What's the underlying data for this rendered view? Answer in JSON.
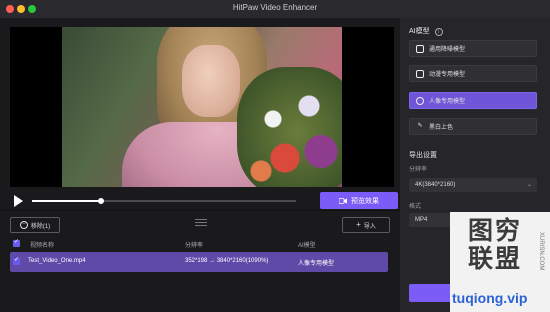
{
  "window": {
    "title": "HitPaw Video Enhancer"
  },
  "player": {
    "progress": 0.26,
    "preview_button": "预览效果"
  },
  "toolbar": {
    "remove_label": "移除(1)",
    "import_label": "导入"
  },
  "table": {
    "headers": [
      "视频名称",
      "分辨率",
      "AI模型"
    ],
    "rows": [
      {
        "name": "Test_Video_One.mp4",
        "resolution": "352*198 → 3840*2160(1090%)",
        "model": "人像专用模型"
      }
    ]
  },
  "ai_panel": {
    "title": "AI模型",
    "models": [
      {
        "label": "通用降噪模型",
        "icon": "film-icon",
        "active": false
      },
      {
        "label": "动漫专用模型",
        "icon": "anime-icon",
        "active": false
      },
      {
        "label": "人像专用模型",
        "icon": "face-icon",
        "active": true
      },
      {
        "label": "黑白上色",
        "icon": "brush-icon",
        "active": false
      }
    ]
  },
  "export": {
    "title": "导出设置",
    "resolution_label": "分辨率",
    "resolution_value": "4K(3840*2160)",
    "format_label": "格式",
    "format_value": "MP4"
  },
  "watermark": {
    "line1": "图穷",
    "line2": "联盟",
    "side_text": "XURISN.COM",
    "url": "tuqiong.vip"
  },
  "colors": {
    "accent": "#7b5cf6",
    "selected_row": "#5f4aa8"
  }
}
